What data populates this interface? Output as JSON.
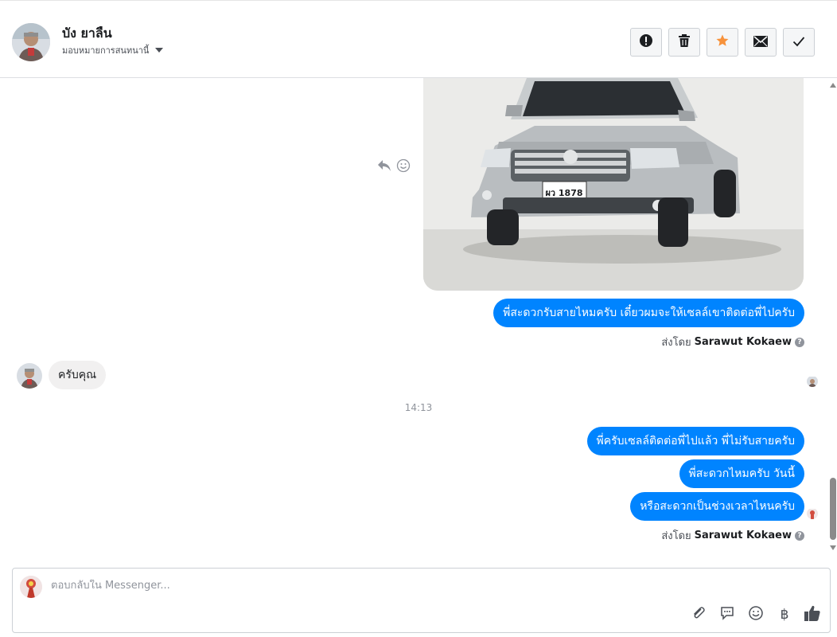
{
  "header": {
    "contact_name": "บัง ยาลืน",
    "assign_label": "มอบหมายการสนทนานี้"
  },
  "header_actions": [
    {
      "icon": "alert-circle-icon"
    },
    {
      "icon": "trash-icon"
    },
    {
      "icon": "star-icon",
      "color": "#f7923b"
    },
    {
      "icon": "envelope-icon"
    },
    {
      "icon": "checkmark-icon"
    }
  ],
  "conversation": {
    "outgoing_1": "พี่สะดวกรับสายไหมครับ เดี๋ยวผมจะให้เซลล์เขาติดต่อพี่ไปครับ",
    "sent_by_1": {
      "prefix": "ส่งโดย",
      "name": "Sarawut Kokaew"
    },
    "incoming_1": "ครับคุณ",
    "timestamp": "14:13",
    "outgoing_2": "พี่ครับเซลล์ติดต่อพี่ไปแล้ว พี่ไม่รับสายครับ",
    "outgoing_3": "พี่สะดวกไหมครับ วันนี้",
    "outgoing_4": "หรือสะดวกเป็นช่วงเวลาไหนครับ",
    "sent_by_2": {
      "prefix": "ส่งโดย",
      "name": "Sarawut Kokaew"
    },
    "car_plate": "ผว 1878"
  },
  "composer": {
    "placeholder": "ตอบกลับใน Messenger..."
  },
  "colors": {
    "outgoing_bubble": "#0084ff",
    "incoming_bubble": "#f1f0f0",
    "like_icon": "#4b4f56"
  }
}
